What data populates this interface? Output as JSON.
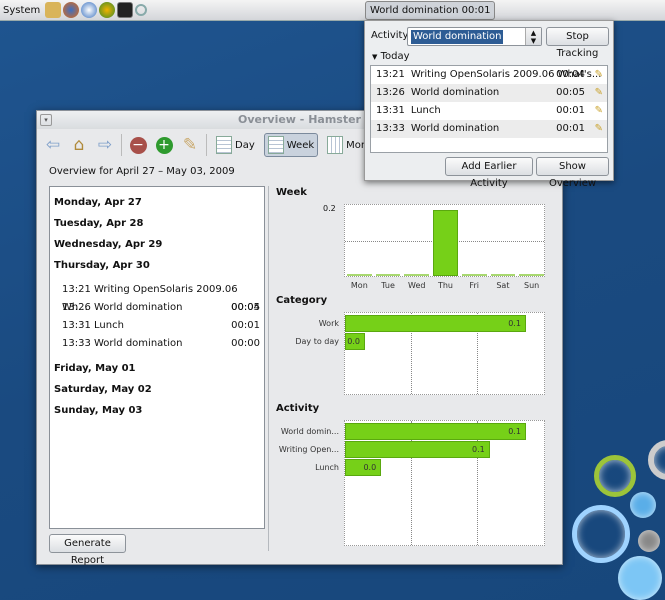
{
  "panel": {
    "system_label": "System",
    "tray_label": "World domination 00:01",
    "launchers": [
      "home-icon",
      "firefox-icon",
      "thunderbird-icon",
      "update-icon",
      "terminal-icon",
      "search-icon"
    ]
  },
  "popup": {
    "activity_label": "Activity:",
    "activity_value": "World domination",
    "stop_button": "Stop Tracking",
    "today_label": "Today",
    "entries": [
      {
        "time": "13:21",
        "name": "Writing OpenSolaris 2009.06 What's...",
        "duration": "00:04"
      },
      {
        "time": "13:26",
        "name": "World domination",
        "duration": "00:05"
      },
      {
        "time": "13:31",
        "name": "Lunch",
        "duration": "00:01"
      },
      {
        "time": "13:33",
        "name": "World domination",
        "duration": "00:01"
      }
    ],
    "add_button": "Add Earlier Activity",
    "overview_button": "Show Overview"
  },
  "window": {
    "title": "Overview - Hamster",
    "toolbar": {
      "day": "Day",
      "week": "Week",
      "month": "Month",
      "active_view": "Week"
    },
    "range_label": "Overview for April 27 – May 03, 2009",
    "days": [
      {
        "label": "Monday, Apr 27",
        "entries": []
      },
      {
        "label": "Tuesday, Apr 28",
        "entries": []
      },
      {
        "label": "Wednesday, Apr 29",
        "entries": []
      },
      {
        "label": "Thursday, Apr 30",
        "entries": [
          {
            "text": "13:21 Writing OpenSolaris 2009.06 Wh...",
            "duration": "00:04"
          },
          {
            "text": "13:26 World domination",
            "duration": "00:05"
          },
          {
            "text": "13:31 Lunch",
            "duration": "00:01"
          },
          {
            "text": "13:33 World domination",
            "duration": "00:00"
          }
        ]
      },
      {
        "label": "Friday, May 01",
        "entries": []
      },
      {
        "label": "Saturday, May 02",
        "entries": []
      },
      {
        "label": "Sunday, May 03",
        "entries": []
      }
    ],
    "report_button": "Generate Report"
  },
  "accent": "#76d018",
  "chart_data": [
    {
      "type": "bar",
      "title": "Week",
      "categories": [
        "Mon",
        "Tue",
        "Wed",
        "Thu",
        "Fri",
        "Sat",
        "Sun"
      ],
      "values": [
        0,
        0,
        0,
        0.19,
        0,
        0,
        0
      ],
      "ylim": [
        0,
        0.2
      ],
      "ytick_label": "0.2",
      "grid": true
    },
    {
      "type": "bar",
      "orientation": "horizontal",
      "title": "Category",
      "categories": [
        "Work",
        "Day to day"
      ],
      "values": [
        0.1,
        0.01
      ],
      "labels": [
        "0.1",
        "0.0"
      ],
      "grid": true
    },
    {
      "type": "bar",
      "orientation": "horizontal",
      "title": "Activity",
      "categories": [
        "World domin...",
        "Writing Open...",
        "Lunch"
      ],
      "values": [
        0.1,
        0.08,
        0.02
      ],
      "labels": [
        "0.1",
        "0.1",
        "0.0"
      ],
      "grid": true
    }
  ]
}
